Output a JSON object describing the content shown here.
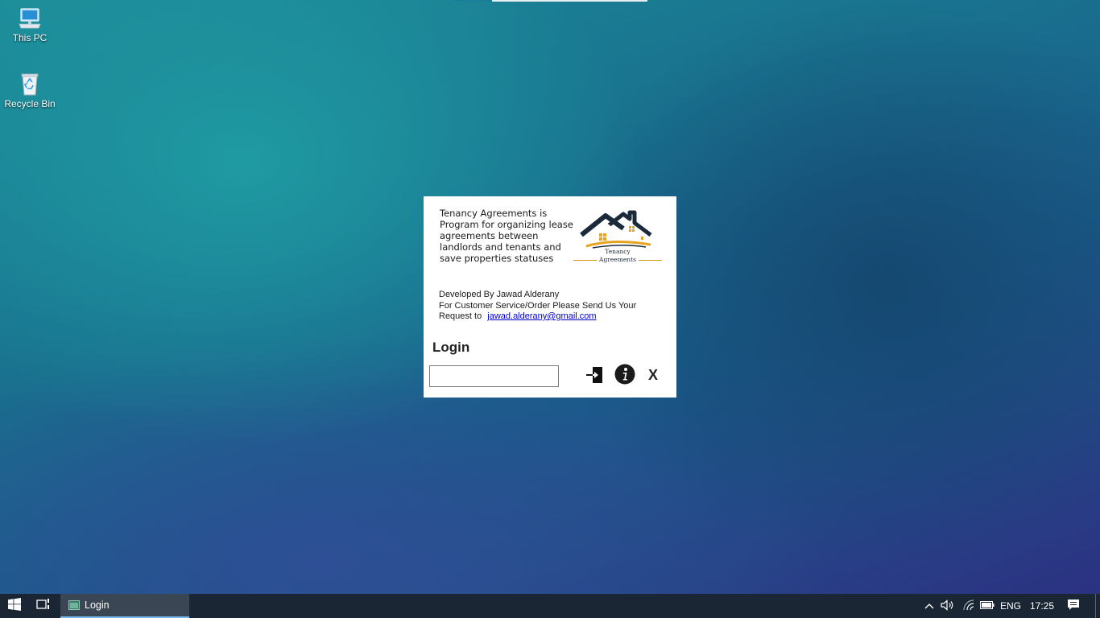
{
  "desktop": {
    "icons": [
      {
        "label": "This PC"
      },
      {
        "label": "Recycle Bin"
      }
    ]
  },
  "login_window": {
    "about_text": "Tenancy Agreements is Program for organizing lease agreements between landlords and tenants and save properties statuses",
    "logo_caption_line1": "Tenancy",
    "logo_caption_line2": "Agreements",
    "developer_line": "Developed By Jawad Alderany",
    "service_line": "For Customer Service/Order Please Send Us Your",
    "request_prefix": "Request to",
    "email_link": "jawad.alderany@gmail.com",
    "login_title": "Login",
    "password_value": "",
    "close_label": "X",
    "icons": {
      "login": "sign-in-arrow-icon",
      "info": "info-icon"
    }
  },
  "taskbar": {
    "app_label": "Login",
    "language": "ENG",
    "time": "17:25"
  },
  "colors": {
    "taskbar_bg": "#1a2634",
    "active_app_bg": "#3a4654",
    "active_app_underline": "#76b9ed",
    "link": "#0000cc",
    "logo_gold": "#d79a22",
    "logo_dark": "#1b2a3a"
  }
}
